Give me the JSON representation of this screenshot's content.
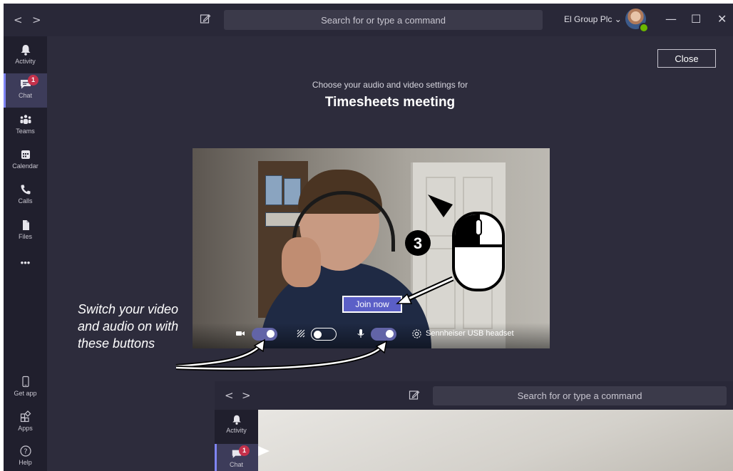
{
  "titlebar": {
    "back": "<",
    "forward": ">",
    "search_placeholder": "Search for or type a command",
    "org": "El Group Plc ⌄",
    "minimize": "—",
    "maximize": "☐",
    "close": "✕"
  },
  "rail": {
    "activity": "Activity",
    "chat": "Chat",
    "chat_badge": "1",
    "teams": "Teams",
    "calendar": "Calendar",
    "calls": "Calls",
    "files": "Files",
    "more": "•••",
    "get_app": "Get app",
    "apps": "Apps",
    "help": "Help"
  },
  "meeting": {
    "close_label": "Close",
    "subtitle": "Choose your audio and video settings for",
    "title": "Timesheets meeting",
    "join_label": "Join now",
    "audio_device": "Sennheiser USB headset",
    "video_on": true,
    "background_blur_on": false,
    "mic_on": true
  },
  "annotation": {
    "step_number": "3",
    "caption": "Switch your video and audio on with these buttons"
  },
  "inset": {
    "back": "<",
    "forward": ">",
    "search_placeholder": "Search for or type a command",
    "activity": "Activity",
    "chat": "Chat",
    "chat_badge": "1"
  },
  "colors": {
    "accent": "#6264a7",
    "join_button": "#5b5fc7",
    "badge": "#c4314b",
    "presence": "#6bb700"
  }
}
